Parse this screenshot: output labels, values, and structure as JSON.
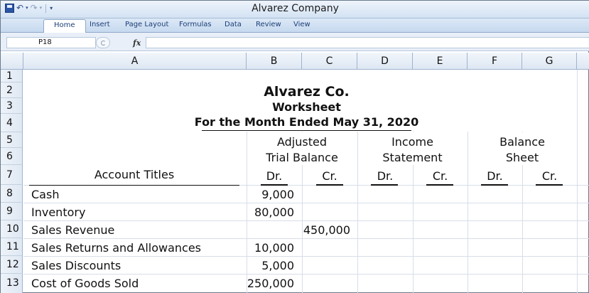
{
  "window": {
    "title": "Alvarez Company"
  },
  "quick_access": {
    "icons": [
      "save-icon",
      "undo-icon",
      "redo-icon",
      "customize-icon"
    ]
  },
  "ribbon": {
    "tabs": [
      {
        "label": "Home",
        "active": true
      },
      {
        "label": "Insert"
      },
      {
        "label": "Page Layout"
      },
      {
        "label": "Formulas"
      },
      {
        "label": "Data"
      },
      {
        "label": "Review"
      },
      {
        "label": "View"
      }
    ]
  },
  "formula_bar": {
    "cell_ref": "P18",
    "fx_label": "fx",
    "value": ""
  },
  "columns": [
    "A",
    "B",
    "C",
    "D",
    "E",
    "F",
    "G"
  ],
  "rows": [
    "1",
    "2",
    "3",
    "4",
    "5",
    "6",
    "7",
    "8",
    "9",
    "10",
    "11",
    "12",
    "13"
  ],
  "sheet": {
    "heading": {
      "company": "Alvarez Co.",
      "title": "Worksheet",
      "period": "For the Month Ended May 31, 2020"
    },
    "groups": [
      {
        "line1": "Adjusted",
        "line2": "Trial Balance"
      },
      {
        "line1": "Income",
        "line2": "Statement"
      },
      {
        "line1": "Balance",
        "line2": "Sheet"
      }
    ],
    "account_titles_label": "Account Titles",
    "dr_label": "Dr.",
    "cr_label": "Cr.",
    "accounts": [
      {
        "name": "Cash",
        "dr": "9,000",
        "cr": ""
      },
      {
        "name": "Inventory",
        "dr": "80,000",
        "cr": ""
      },
      {
        "name": "Sales Revenue",
        "dr": "",
        "cr": "450,000"
      },
      {
        "name": "Sales Returns and Allowances",
        "dr": "10,000",
        "cr": ""
      },
      {
        "name": "Sales Discounts",
        "dr": "5,000",
        "cr": ""
      },
      {
        "name": "Cost of Goods Sold",
        "dr": "250,000",
        "cr": ""
      }
    ]
  }
}
